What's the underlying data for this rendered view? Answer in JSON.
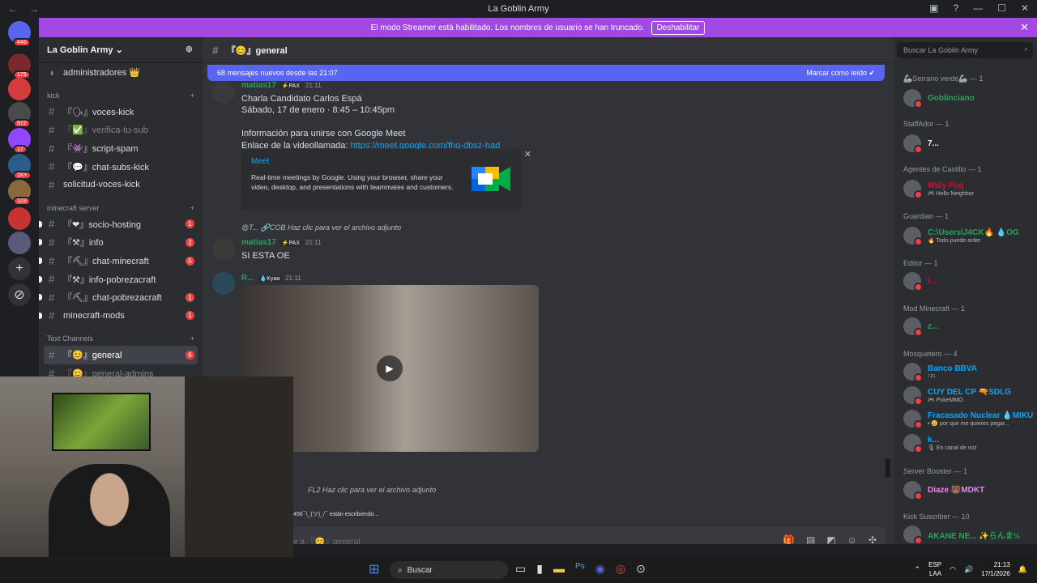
{
  "window": {
    "title": "La Goblin Army",
    "nav_back": "←",
    "nav_fwd": "→",
    "win_controls": [
      "▣",
      "?",
      "—",
      "☐",
      "✕"
    ]
  },
  "banner": {
    "text": "El modo Streamer está habilitado. Los nombres de usuario se han truncado.",
    "button": "Deshabilitar",
    "close": "✕"
  },
  "servers": {
    "badges": [
      "446",
      "179",
      "972",
      "17",
      "1K+",
      "103"
    ],
    "add": "+",
    "explore": "⊘"
  },
  "guild": {
    "name": "La Goblin Army",
    "chevron": "⌄"
  },
  "channels": {
    "top_item": "administradores 👑",
    "categories": [
      {
        "name": "kick",
        "items": [
          {
            "label": "『🗣』voces-kick",
            "badge": ""
          },
          {
            "label": "『✅』verifica-tu-sub",
            "badge": "",
            "dim": true
          },
          {
            "label": "『👾』script-spam",
            "badge": ""
          },
          {
            "label": "『💬』chat-subs-kick",
            "badge": ""
          },
          {
            "label": "solicitud-voces-kick",
            "badge": ""
          }
        ]
      },
      {
        "name": "minecraft server",
        "items": [
          {
            "label": "『❤』socio-hosting",
            "badge": "1"
          },
          {
            "label": "『⚒』info",
            "badge": "2"
          },
          {
            "label": "『⛏』chat-minecraft",
            "badge": "5"
          },
          {
            "label": "『⚒』info-pobrezacraft",
            "badge": ""
          },
          {
            "label": "『⛏』chat-pobrezacraft",
            "badge": "1"
          },
          {
            "label": "minecraft-mods",
            "badge": "1"
          }
        ]
      },
      {
        "name": "Text Channels",
        "items": [
          {
            "label": "『😊』general",
            "badge": "6",
            "active": true
          },
          {
            "label": "『😊』general-admins",
            "badge": "",
            "dim": true
          }
        ]
      }
    ]
  },
  "chat": {
    "channel": "『😊』general",
    "new_messages": "68 mensajes nuevos desde las 21:07",
    "mark_read": "Marcar como leído",
    "messages": [
      {
        "user": "matias17",
        "tag": "⚡PAX",
        "time": "21:11",
        "lines": [
          "Charla Candidato Carlos Espá",
          "Sábado, 17 de enero · 8:45 – 10:45pm",
          "",
          "Información para unirse con Google Meet"
        ],
        "link_prefix": "Enlace de la videollamada: ",
        "link": "https://meet.google.com/fhg-dbsz-had"
      },
      {
        "reply": "@T... 🔗COB  Haz clic para ver el archivo adjunto",
        "user": "matias17",
        "tag": "⚡PAX",
        "time": "21:11",
        "text": "SI ESTA OE"
      },
      {
        "user": "R...",
        "tag": "💧Kyaa",
        "time": "21:11"
      },
      {
        "reply": "FL2  Haz clic para ver el archivo adjunto"
      }
    ],
    "embed": {
      "title": "Meet",
      "desc": "Real-time meetings by Google. Using your browser, share your video, desktop, and presentations with teammates and customers."
    },
    "typing": "456¯\\_(ツ)_/¯ están escribiendo...",
    "input_placeholder": "e a 『😊』general"
  },
  "members": {
    "search_placeholder": "Buscar La Goblin Army",
    "groups": [
      {
        "name": "🦾Serrano verde🦾 — 1",
        "members": [
          {
            "name": "Goblinciano",
            "status": "",
            "color": "#23a55a"
          }
        ]
      },
      {
        "name": "StaffAdor — 1",
        "members": [
          {
            "name": "7...",
            "status": "",
            "color": "#f2f3f5"
          }
        ]
      },
      {
        "name": "Agentes de Castillo — 1",
        "members": [
          {
            "name": "Willy Fog",
            "status": "🎮 Hello Neighbor",
            "color": "#c8102e"
          }
        ]
      },
      {
        "name": "Guardian — 1",
        "members": [
          {
            "name": "C:\\Users\\J4CK🔥 💧OG",
            "status": "🔥 Todo puede arder",
            "color": "#23a55a"
          }
        ]
      },
      {
        "name": "Editor — 1",
        "members": [
          {
            "name": "i...",
            "status": "",
            "color": "#c8102e"
          }
        ]
      },
      {
        "name": "Mod Minecraft — 1",
        "members": [
          {
            "name": "z...",
            "status": "",
            "color": "#23a55a"
          }
        ]
      },
      {
        "name": "Mosquetero — 4",
        "members": [
          {
            "name": "Banco BBVA",
            "status": "↑z↓",
            "color": "#00a8fc"
          },
          {
            "name": "CUY DEL CP 🔫SDLG",
            "status": "🎮 PokeMMO",
            "color": "#00a8fc"
          },
          {
            "name": "Fracasado Nuclear 💧MIKU",
            "status": "• 😢 por que me quieres pegar...",
            "color": "#00a8fc"
          },
          {
            "name": "k...",
            "status": "🎙 En canal de voz",
            "color": "#00a8fc"
          }
        ]
      },
      {
        "name": "Server Booster — 1",
        "members": [
          {
            "name": "Diaze 🐻MDKT",
            "status": "",
            "color": "#f47fff"
          }
        ]
      },
      {
        "name": "Kick Suscriber — 10",
        "members": [
          {
            "name": "AKANE NE... ✨らんま½",
            "status": "",
            "color": "#23a55a"
          }
        ]
      }
    ]
  },
  "taskbar": {
    "search": "Buscar",
    "lang": "ESP",
    "region": "LAA",
    "time": "21:13",
    "date": "17/1/2026"
  }
}
